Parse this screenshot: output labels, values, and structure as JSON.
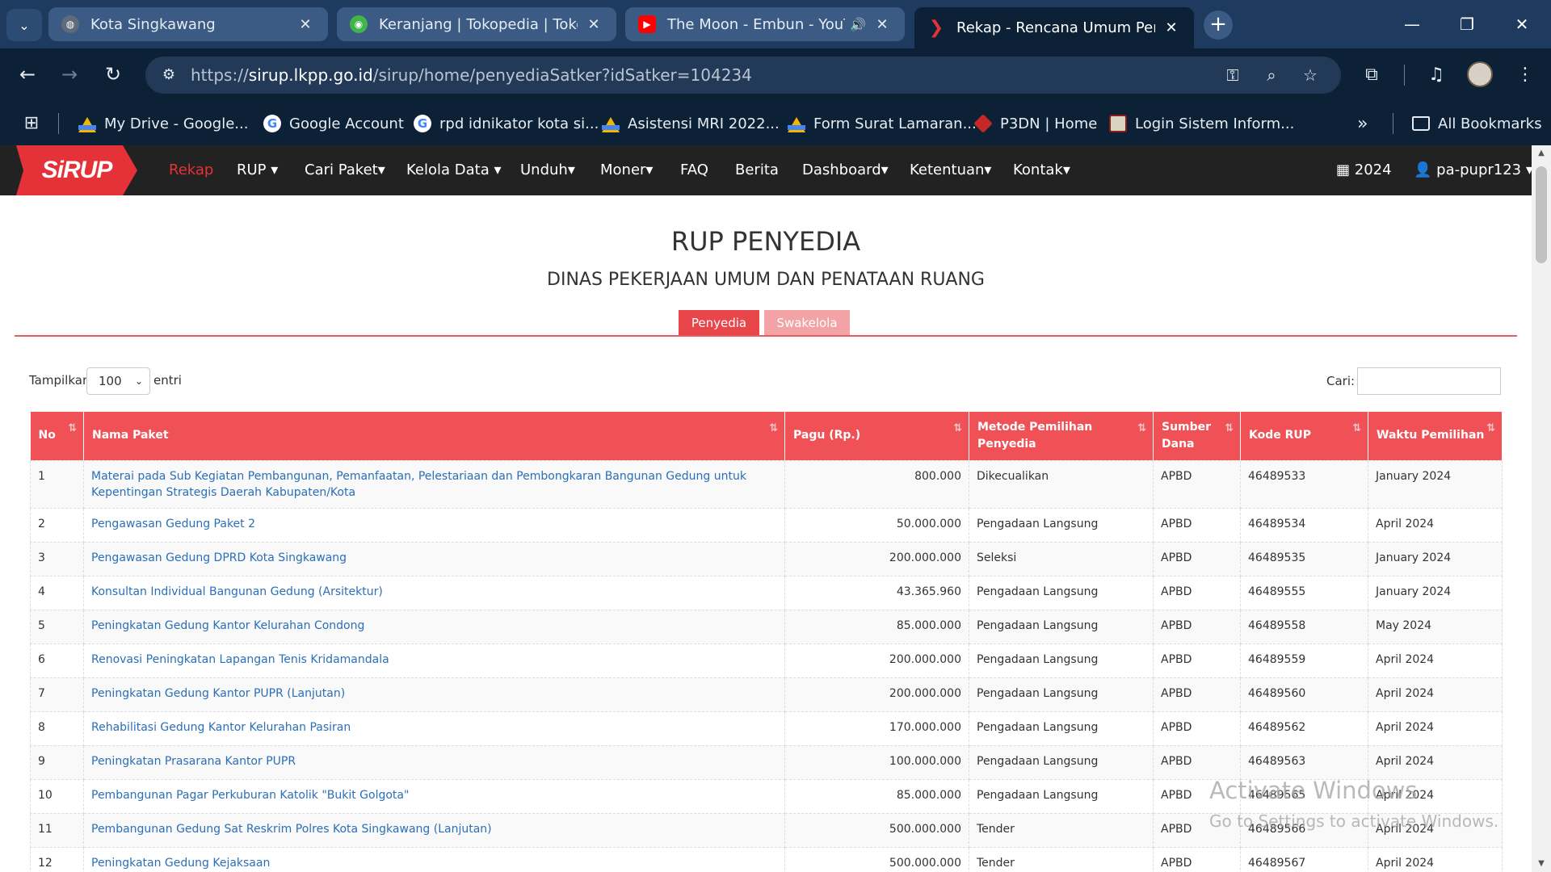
{
  "browser": {
    "tabs": [
      {
        "title": "Kota Singkawang",
        "icon": "globe-icon",
        "color": "#5f6b7a"
      },
      {
        "title": "Keranjang | Tokopedia | Tokopedia",
        "icon": "tokopedia-icon",
        "color": "#42b549"
      },
      {
        "title": "The Moon - Embun - YouTube",
        "icon": "youtube-icon",
        "color": "#ff0000"
      },
      {
        "title": "Rekap - Rencana Umum Pengadaan",
        "icon": "sirup-icon",
        "color": "#e53238"
      }
    ],
    "url_scheme": "https://",
    "url_host": "sirup.lkpp.go.id",
    "url_path": "/sirup/home/penyediaSatker?idSatker=104234",
    "bookmarks": [
      {
        "label": "My Drive - Google...",
        "icon": "drive-icon"
      },
      {
        "label": "Google Account",
        "icon": "google-icon"
      },
      {
        "label": "rpd idnikator kota si...",
        "icon": "google-icon"
      },
      {
        "label": "Asistensi MRI 2022...",
        "icon": "drive-icon"
      },
      {
        "label": "Form Surat Lamaran...",
        "icon": "drive-icon"
      },
      {
        "label": "P3DN | Home",
        "icon": "p3dn-icon"
      },
      {
        "label": "Login Sistem Inform...",
        "icon": "sistem-icon"
      }
    ],
    "all_bookmarks": "All Bookmarks",
    "overflow": "»"
  },
  "site": {
    "logo": "SiRUP",
    "nav": [
      {
        "label": "Rekap",
        "active": true
      },
      {
        "label": "RUP ▾"
      },
      {
        "label": "Cari Paket▾"
      },
      {
        "label": "Kelola Data ▾"
      },
      {
        "label": "Unduh▾"
      },
      {
        "label": "Moner▾"
      },
      {
        "label": "FAQ"
      },
      {
        "label": "Berita"
      },
      {
        "label": "Dashboard▾"
      },
      {
        "label": "Ketentuan▾"
      },
      {
        "label": "Kontak▾"
      }
    ],
    "year": "2024",
    "user": "pa-pupr123 ▾"
  },
  "page": {
    "title": "RUP PENYEDIA",
    "subtitle": "DINAS PEKERJAAN UMUM DAN PENATAAN RUANG",
    "tab_penyedia": "Penyedia",
    "tab_swakelola": "Swakelola",
    "length_label": "Tampilkan",
    "length_value": "100",
    "length_suffix": "entri",
    "search_label": "Cari:"
  },
  "table": {
    "headers": [
      "No",
      "Nama Paket",
      "Pagu (Rp.)",
      "Metode Pemilihan Penyedia",
      "Sumber Dana",
      "Kode RUP",
      "Waktu Pemilihan"
    ],
    "rows": [
      [
        "1",
        "Materai pada Sub Kegiatan Pembangunan, Pemanfaatan, Pelestariaan dan Pembongkaran Bangunan Gedung untuk Kepentingan Strategis Daerah Kabupaten/Kota",
        "800.000",
        "Dikecualikan",
        "APBD",
        "46489533",
        "January 2024"
      ],
      [
        "2",
        "Pengawasan Gedung Paket 2",
        "50.000.000",
        "Pengadaan Langsung",
        "APBD",
        "46489534",
        "April 2024"
      ],
      [
        "3",
        "Pengawasan Gedung DPRD Kota Singkawang",
        "200.000.000",
        "Seleksi",
        "APBD",
        "46489535",
        "January 2024"
      ],
      [
        "4",
        "Konsultan Individual Bangunan Gedung (Arsitektur)",
        "43.365.960",
        "Pengadaan Langsung",
        "APBD",
        "46489555",
        "January 2024"
      ],
      [
        "5",
        "Peningkatan Gedung Kantor Kelurahan Condong",
        "85.000.000",
        "Pengadaan Langsung",
        "APBD",
        "46489558",
        "May 2024"
      ],
      [
        "6",
        "Renovasi Peningkatan Lapangan Tenis Kridamandala",
        "200.000.000",
        "Pengadaan Langsung",
        "APBD",
        "46489559",
        "April 2024"
      ],
      [
        "7",
        "Peningkatan Gedung Kantor PUPR (Lanjutan)",
        "200.000.000",
        "Pengadaan Langsung",
        "APBD",
        "46489560",
        "April 2024"
      ],
      [
        "8",
        "Rehabilitasi Gedung Kantor Kelurahan Pasiran",
        "170.000.000",
        "Pengadaan Langsung",
        "APBD",
        "46489562",
        "April 2024"
      ],
      [
        "9",
        "Peningkatan Prasarana Kantor PUPR",
        "100.000.000",
        "Pengadaan Langsung",
        "APBD",
        "46489563",
        "April 2024"
      ],
      [
        "10",
        "Pembangunan Pagar Perkuburan Katolik \"Bukit Golgota\"",
        "85.000.000",
        "Pengadaan Langsung",
        "APBD",
        "46489565",
        "April 2024"
      ],
      [
        "11",
        "Pembangunan Gedung Sat Reskrim Polres Kota Singkawang (Lanjutan)",
        "500.000.000",
        "Tender",
        "APBD",
        "46489566",
        "April 2024"
      ],
      [
        "12",
        "Peningkatan Gedung Kejaksaan",
        "500.000.000",
        "Tender",
        "APBD",
        "46489567",
        "April 2024"
      ]
    ]
  },
  "watermark": {
    "line1": "Activate Windows",
    "line2": "Go to Settings to activate Windows."
  },
  "colors": {
    "accent": "#e53238",
    "header_bg": "#ef5157",
    "link": "#2a6fb8"
  }
}
